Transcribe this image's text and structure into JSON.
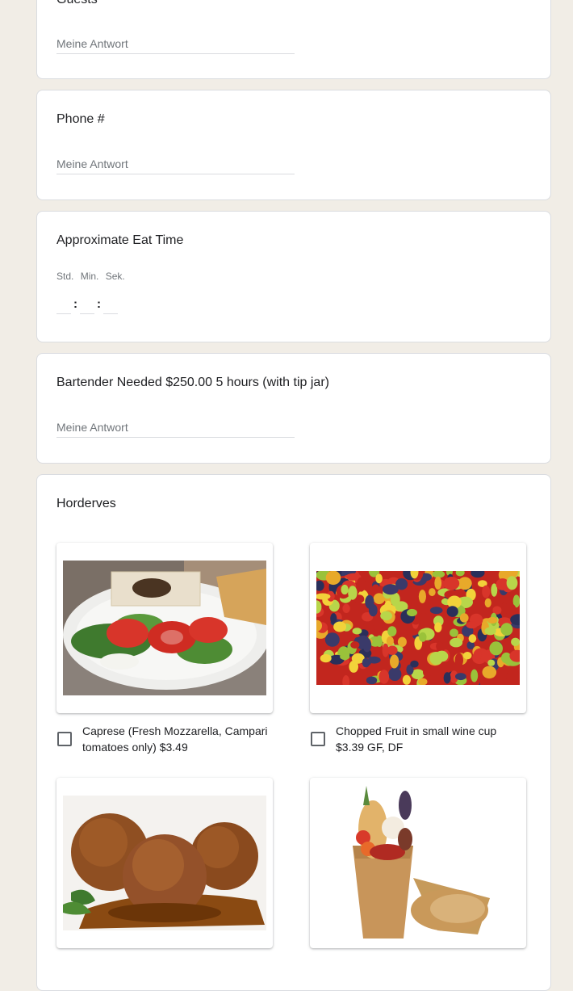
{
  "guests": {
    "title": "Guests",
    "answer_placeholder": "Meine Antwort"
  },
  "phone": {
    "title": "Phone #",
    "answer_placeholder": "Meine Antwort"
  },
  "eat_time": {
    "title": "Approximate Eat Time",
    "labels": {
      "hours": "Std.",
      "minutes": "Min.",
      "seconds": "Sek."
    },
    "separator": ":"
  },
  "bartender": {
    "title": "Bartender Needed $250.00  5 hours (with tip jar)",
    "answer_placeholder": "Meine Antwort"
  },
  "horderves": {
    "title": "Horderves",
    "options": [
      {
        "line1": "Caprese (Fresh Mozzarella, Campari",
        "line2": "tomatoes only)  $3.49",
        "image": "caprese-salad-photo",
        "checked": false
      },
      {
        "line1": "Chopped Fruit in small wine cup",
        "line2": "$3.39 GF, DF",
        "image": "chopped-fruit-photo",
        "checked": false
      },
      {
        "line1": "",
        "line2": "",
        "image": "meatballs-photo",
        "checked": false
      },
      {
        "line1": "",
        "line2": "",
        "image": "charcuterie-cone-photo",
        "checked": false
      }
    ]
  },
  "colors": {
    "background": "#f1ede6",
    "card": "#ffffff",
    "text": "#202124",
    "muted": "#70757a",
    "border": "#dadce0"
  }
}
